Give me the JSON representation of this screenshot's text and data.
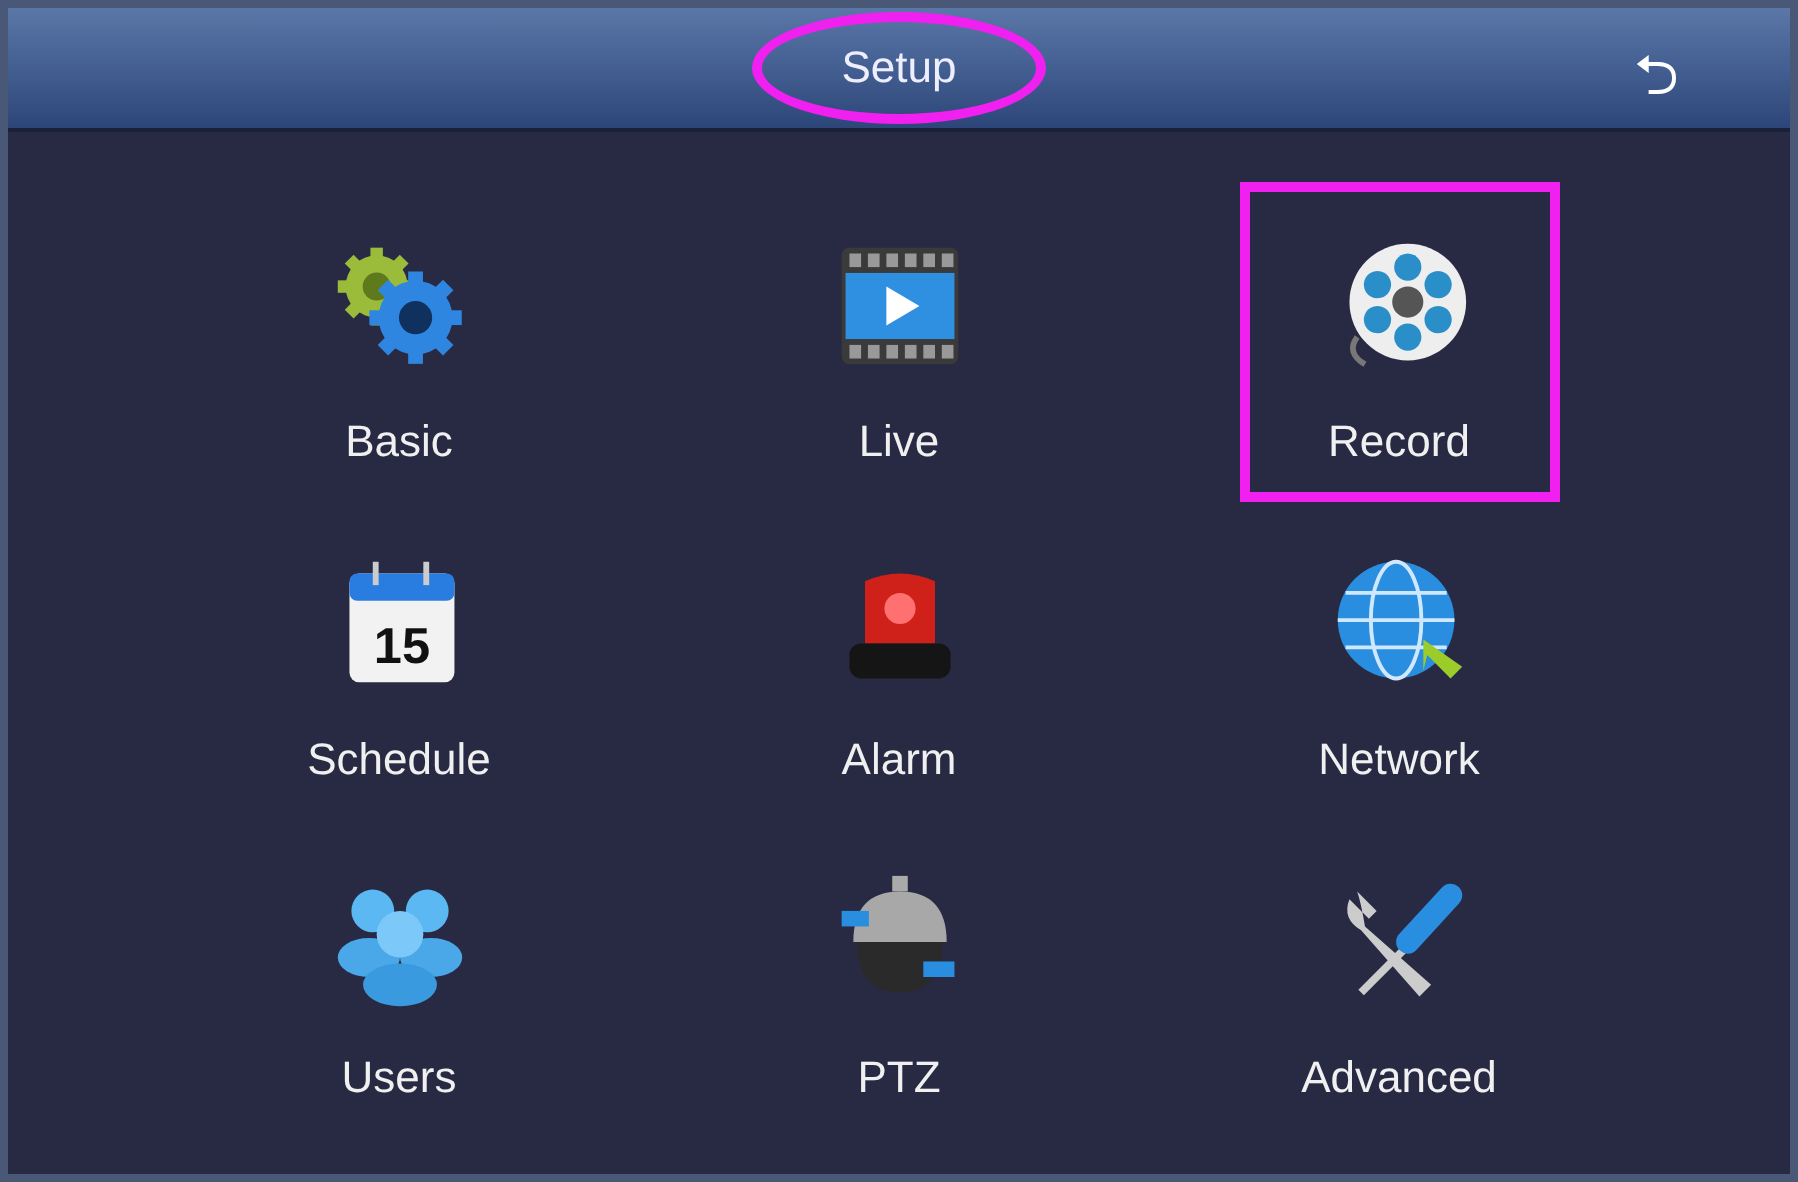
{
  "header": {
    "title": "Setup",
    "title_circled": true,
    "back_button": "⮌"
  },
  "items": [
    {
      "label": "Basic",
      "kind": "gears",
      "highlighted": false
    },
    {
      "label": "Live",
      "kind": "film",
      "highlighted": false
    },
    {
      "label": "Record",
      "kind": "reel",
      "highlighted": true
    },
    {
      "label": "Schedule",
      "kind": "calendar",
      "icon_text": "15",
      "highlighted": false
    },
    {
      "label": "Alarm",
      "kind": "siren",
      "highlighted": false
    },
    {
      "label": "Network",
      "kind": "globe",
      "highlighted": false
    },
    {
      "label": "Users",
      "kind": "users",
      "highlighted": false
    },
    {
      "label": "PTZ",
      "kind": "camera",
      "highlighted": false
    },
    {
      "label": "Advanced",
      "kind": "tools",
      "highlighted": false
    }
  ]
}
